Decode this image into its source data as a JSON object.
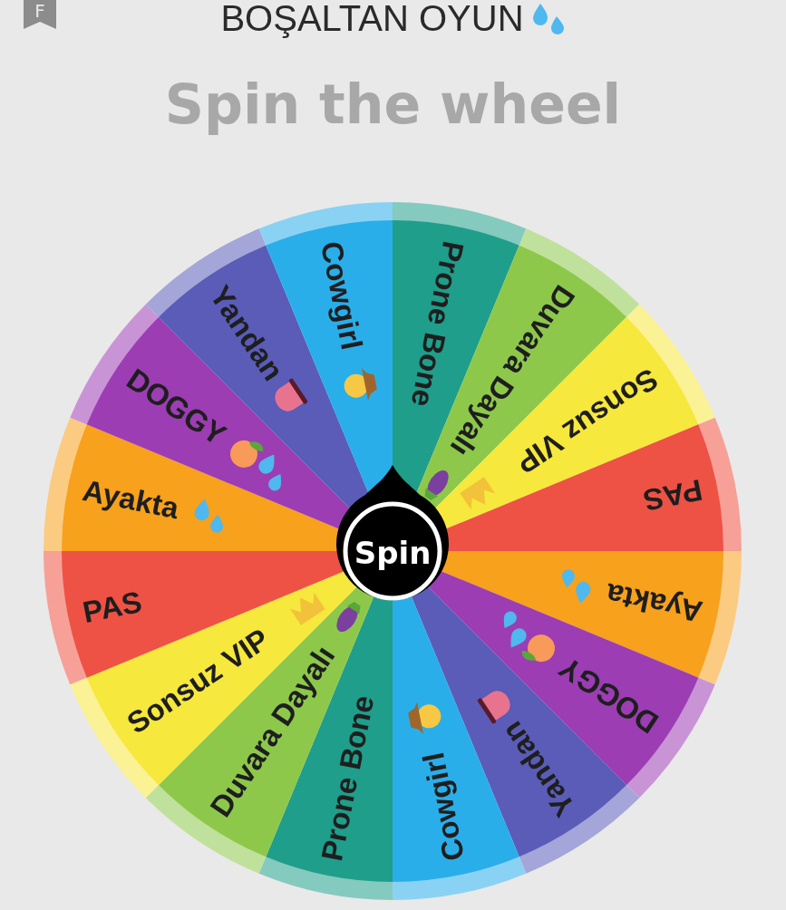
{
  "header": {
    "badge": "F",
    "title": "BOŞALTAN OYUN",
    "title_icon": {
      "kind": "drops"
    }
  },
  "heading": "Spin the wheel",
  "wheel": {
    "segments": [
      {
        "label": "Prone Bone",
        "color": "#1f9e8b"
      },
      {
        "label": "Duvara Dayalı",
        "color": "#8dc84b",
        "icons": [
          {
            "kind": "eggplant"
          }
        ]
      },
      {
        "label": "Sonsuz VIP",
        "color": "#f6e83c",
        "icons": [
          {
            "kind": "crown"
          }
        ]
      },
      {
        "label": "PAS",
        "color": "#ee5244"
      },
      {
        "label": "Ayakta",
        "color": "#f7a11c",
        "icons": [
          {
            "kind": "drops"
          }
        ]
      },
      {
        "label": "DOGGY",
        "color": "#9c3db4",
        "icons": [
          {
            "kind": "peach"
          },
          {
            "kind": "drops"
          }
        ]
      },
      {
        "label": "Yandan",
        "color": "#5a5cb8",
        "icons": [
          {
            "kind": "tongue"
          }
        ]
      },
      {
        "label": "Cowgirl",
        "color": "#2aaeea",
        "icons": [
          {
            "kind": "cowboy"
          }
        ]
      },
      {
        "label": "Prone Bone",
        "color": "#1f9e8b"
      },
      {
        "label": "Duvara Dayalı",
        "color": "#8dc84b",
        "icons": [
          {
            "kind": "eggplant"
          }
        ]
      },
      {
        "label": "Sonsuz VIP",
        "color": "#f6e83c",
        "icons": [
          {
            "kind": "crown"
          }
        ]
      },
      {
        "label": "PAS",
        "color": "#ee5244"
      },
      {
        "label": "Ayakta",
        "color": "#f7a11c",
        "icons": [
          {
            "kind": "drops"
          }
        ]
      },
      {
        "label": "DOGGY",
        "color": "#9c3db4",
        "icons": [
          {
            "kind": "peach"
          },
          {
            "kind": "drops"
          }
        ]
      },
      {
        "label": "Yandan",
        "color": "#5a5cb8",
        "icons": [
          {
            "kind": "tongue"
          }
        ]
      },
      {
        "label": "Cowgirl",
        "color": "#2aaeea",
        "icons": [
          {
            "kind": "cowboy"
          }
        ]
      }
    ],
    "button": "Spin"
  }
}
